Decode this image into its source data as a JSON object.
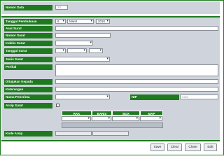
{
  "top": {
    "nomor_data_label": "Nomor Data",
    "nomor_data_value": "33"
  },
  "form": {
    "tanggal_pembukuan_label": "Tanggal Pembukuan",
    "tgl_day": "6",
    "tgl_month": "Maret",
    "tgl_year": "2018",
    "asal_surat_label": "Asal Surat",
    "nomor_surat_label": "Nomor Surat",
    "indeks_surat_label": "Indeks Surat",
    "tanggal_surat_label": "Tanggal Surat",
    "jenis_surat_label": "Jenis Surat",
    "perihal_label": "Perihal",
    "ditujukan_kepada_label": "Ditujukan Kepada",
    "keterangan_label": "Keterangan",
    "nama_penerima_label": "Nama Penerima",
    "nip_label": "NIP",
    "nip_placeholder": "Auto",
    "arsip_surat_label": "Arsip Surat",
    "kode_arsip_label": "Kode Arsip"
  },
  "archive_table": {
    "headers": [
      "RAK",
      "BARIS",
      "BOX",
      "MAP"
    ]
  },
  "buttons": {
    "save": "Save",
    "clear": "Clear",
    "close": "Close",
    "edit": "Edit"
  }
}
